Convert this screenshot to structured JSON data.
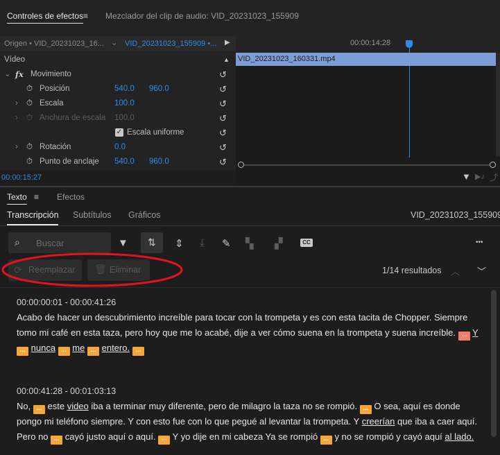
{
  "top_panel": {
    "tab_effect_controls": "Controles de efectos",
    "tab_menu": "≡",
    "tab_audio_mixer": "Mezclador del clip de audio: VID_20231023_155909",
    "source_tab": "Origen • VID_20231023_16...",
    "sequence_tab": "VID_20231023_155909 •...",
    "timecode_ruler": "00:00:14:28",
    "video_label": "Vídeo",
    "movimiento": "Movimiento",
    "fx": "fx",
    "props": {
      "position": {
        "label": "Posición",
        "x": "540.0",
        "y": "960.0"
      },
      "scale": {
        "label": "Escala",
        "value": "100.0"
      },
      "scale_width": {
        "label": "Anchura de escala",
        "value": "100.0"
      },
      "uniform": {
        "label": "Escala uniforme"
      },
      "rotation": {
        "label": "Rotación",
        "value": "0.0"
      },
      "anchor": {
        "label": "Punto de anclaje",
        "x": "540.0",
        "y": "960.0"
      }
    },
    "clip_name": "VID_20231023_160331.mp4",
    "current_timecode": "00:00:15:27"
  },
  "text_panel": {
    "tab_text": "Texto",
    "tab_menu": "≡",
    "tab_effects": "Efectos",
    "subtabs": [
      "Transcripción",
      "Subtítulos",
      "Gráficos"
    ],
    "sequence_name": "VID_20231023_155909",
    "search_placeholder": "Buscar",
    "more": "•••",
    "replace_label": "Reemplazar",
    "delete_label": "Eliminar",
    "results": "1/14 resultados",
    "pause": "...",
    "segments": [
      {
        "time": "00:00:00:01 - 00:00:41:26",
        "t1": "Acabo de hacer un descubrimiento increíble para tocar con la trompeta y es con esta tacita de Chopper. Siempre tomo mi café en esta taza, pero hoy que me lo acabé, dije a ver cómo suena en la trompeta y suena increíble.",
        "w_y": "Y",
        "w_nunca": "nunca",
        "w_me": "me",
        "w_entero": "entero."
      },
      {
        "time": "00:00:41:28 - 00:01:03:13",
        "a1": "No,",
        "a2": "este",
        "a3": "video",
        "a4": "iba a terminar muy diferente, pero de milagro la taza no se rompió.",
        "a5": "O sea, aquí es donde pongo mi teléfono siempre. Y con esto fue con lo que pegué al levantar la trompeta. Y",
        "a6": "creerían",
        "a7": "que iba a caer aquí. Pero no",
        "a8": "cayó justo aquí o aquí.",
        "a9": "Y yo dije en mi cabeza Ya se rompió",
        "a10": "y no se rompió y cayó aquí",
        "a11": "al lado."
      }
    ]
  },
  "colors": {
    "accent_blue": "#2d8ceb",
    "pause_badge": "#f4a638",
    "annotation_red": "#e0141e"
  }
}
